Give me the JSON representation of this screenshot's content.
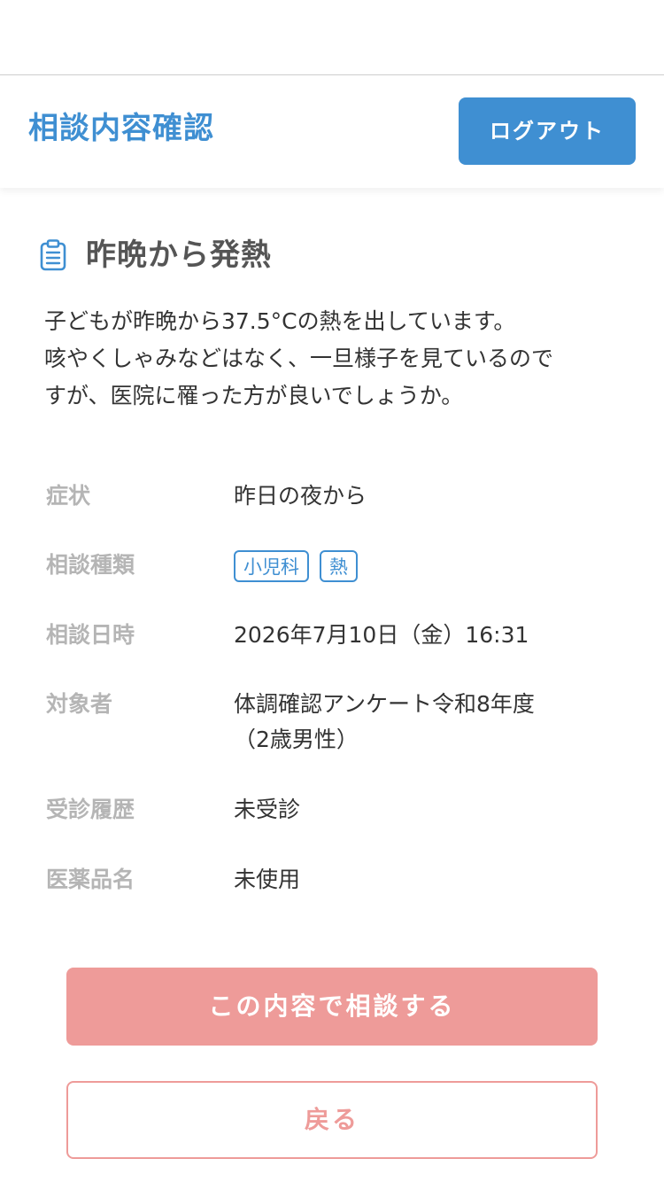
{
  "header": {
    "title": "相談内容確認",
    "logout_label": "ログアウト"
  },
  "topic": {
    "icon": "clipboard-icon",
    "title": "昨晩から発熱",
    "description_lines": [
      "子どもが昨晩から37.5°Cの熱を出しています。",
      "咳やくしゃみなどはなく、一旦様子を見ているので",
      "すが、医院に罹った方が良いでしょうか。"
    ]
  },
  "details": {
    "symptom": {
      "label": "症状",
      "value": "昨日の夜から"
    },
    "category": {
      "label": "相談種類",
      "tags": [
        "小児科",
        "熱"
      ]
    },
    "datetime": {
      "label": "相談日時",
      "value": "2026年7月10日（金）16:31"
    },
    "subject": {
      "label": "対象者",
      "value_lines": [
        "体調確認アンケート令和8年度",
        "（2歳男性）"
      ]
    },
    "visit_history": {
      "label": "受診履歴",
      "value": "未受診"
    },
    "medicine": {
      "label": "医薬品名",
      "value": "未使用"
    }
  },
  "actions": {
    "submit_label": "この内容で相談する",
    "back_label": "戻る"
  },
  "colors": {
    "accent_blue": "#3f8fd2",
    "accent_pink": "#ee9b99",
    "label_gray": "#b5b5b5"
  }
}
